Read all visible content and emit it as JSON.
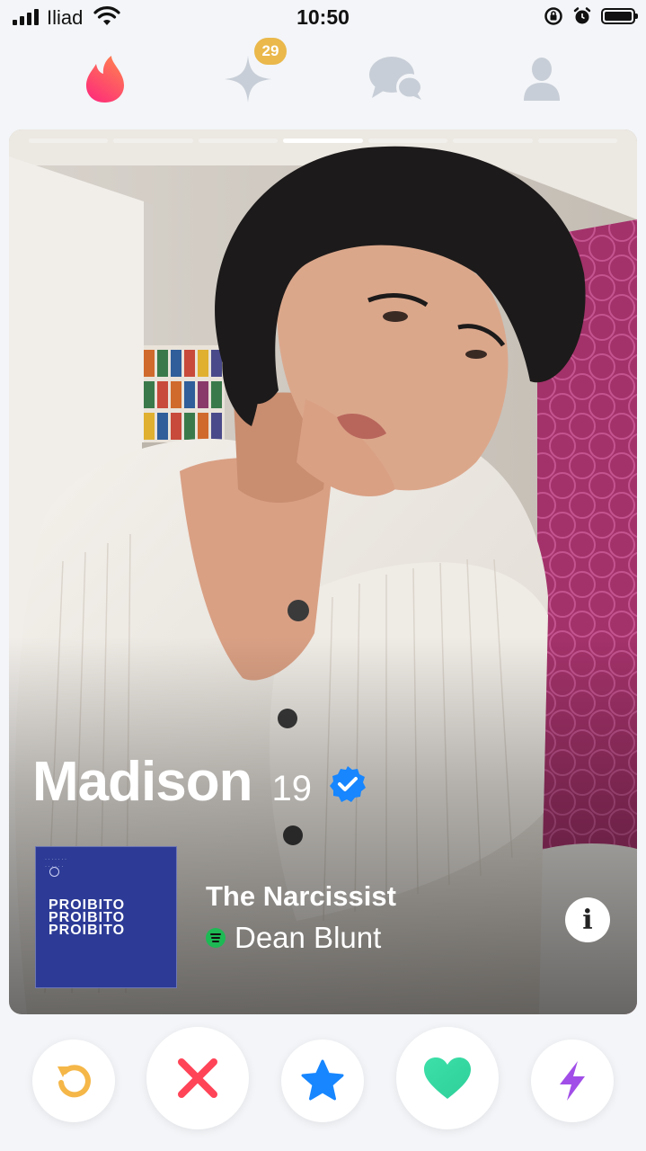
{
  "status_bar": {
    "carrier": "Iliad",
    "time": "10:50"
  },
  "nav": {
    "badge_count": "29"
  },
  "profile": {
    "name": "Madison",
    "age": "19",
    "verified": true
  },
  "anthem": {
    "album_cover_text": "PROIBITO",
    "song_title": "The Narcissist",
    "artist": "Dean Blunt"
  },
  "colors": {
    "brand": "#fd267d",
    "rewind": "#f5b748",
    "nope": "#ff4458",
    "super_like": "#1786ff",
    "like": "#3ce0a8",
    "boost": "#a14ee8",
    "verified": "#1786ff",
    "badge": "#eab84b"
  },
  "icons": {
    "tab_discover": "flame-icon",
    "tab_gold": "sparkle-icon",
    "tab_chat": "chat-bubbles-icon",
    "tab_profile": "person-icon",
    "rewind": "rewind-icon",
    "nope": "x-icon",
    "super_like": "star-icon",
    "like": "heart-icon",
    "boost": "lightning-icon",
    "info": "info-icon"
  }
}
